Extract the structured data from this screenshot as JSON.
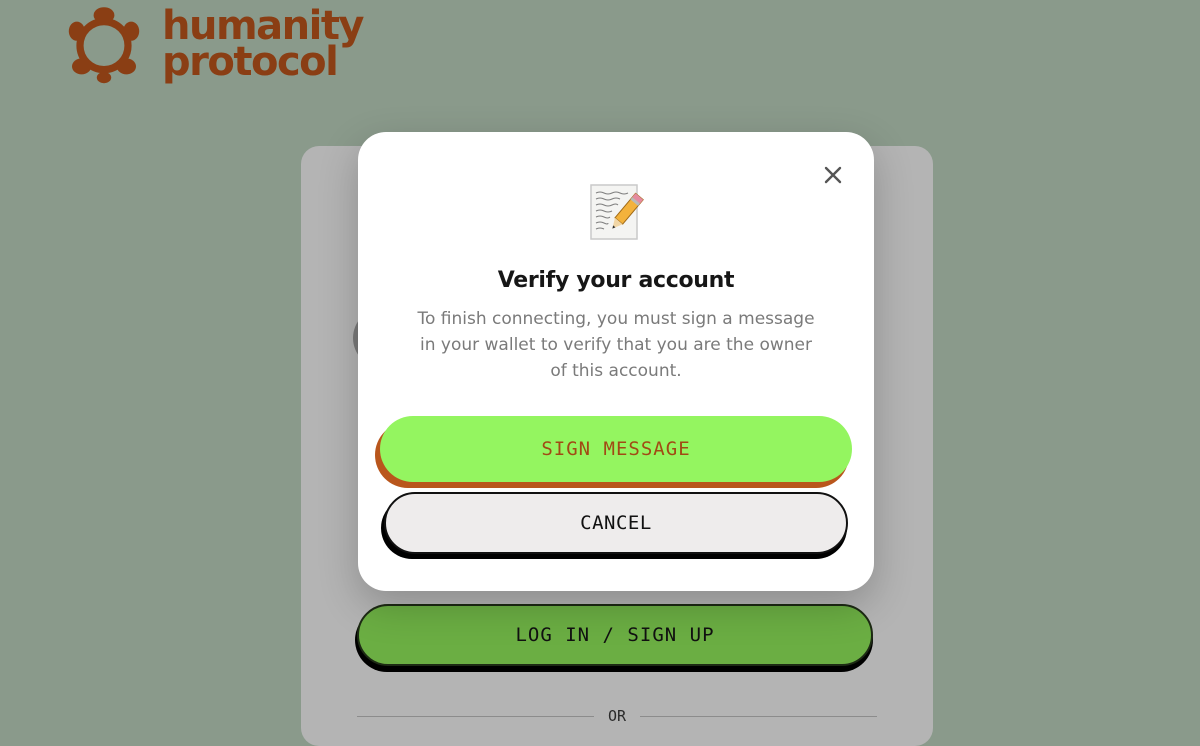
{
  "brand": {
    "line1": "humanity",
    "line2": "protocol",
    "color": "#8a3e14",
    "icon": "humanity-logo-icon"
  },
  "background_card": {
    "login_label": "LOG IN / SIGN UP",
    "or_label": "OR"
  },
  "modal": {
    "icon": "memo-icon",
    "title": "Verify your account",
    "description": "To finish connecting, you must sign a message in your wallet to verify that you are the owner of this account.",
    "sign_label": "SIGN MESSAGE",
    "cancel_label": "CANCEL",
    "close_icon": "close-icon"
  },
  "colors": {
    "page_background": "#8a9a8b",
    "sign_button": "#94f560",
    "sign_button_shadow": "#b9561c",
    "login_button": "#6bae43",
    "cancel_button": "#eeecec"
  }
}
